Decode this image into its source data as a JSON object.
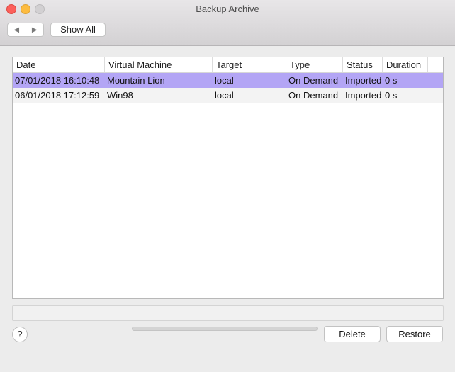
{
  "window": {
    "title": "Backup Archive"
  },
  "toolbar": {
    "back_icon": "◀",
    "forward_icon": "▶",
    "show_all_label": "Show All"
  },
  "table": {
    "columns": [
      "Date",
      "Virtual Machine",
      "Target",
      "Type",
      "Status",
      "Duration"
    ],
    "rows": [
      {
        "date": "07/01/2018 16:10:48",
        "vm": "Mountain Lion",
        "target": "local",
        "type": "On Demand",
        "status": "Imported",
        "duration": "0 s",
        "selected": true
      },
      {
        "date": "06/01/2018 17:12:59",
        "vm": "Win98",
        "target": "local",
        "type": "On Demand",
        "status": "Imported",
        "duration": "0 s",
        "selected": false
      }
    ]
  },
  "footer": {
    "help_label": "?",
    "delete_label": "Delete",
    "restore_label": "Restore"
  },
  "colors": {
    "selection": "#b3a5f5",
    "close": "#fc605b",
    "minimize": "#fdbc40"
  }
}
